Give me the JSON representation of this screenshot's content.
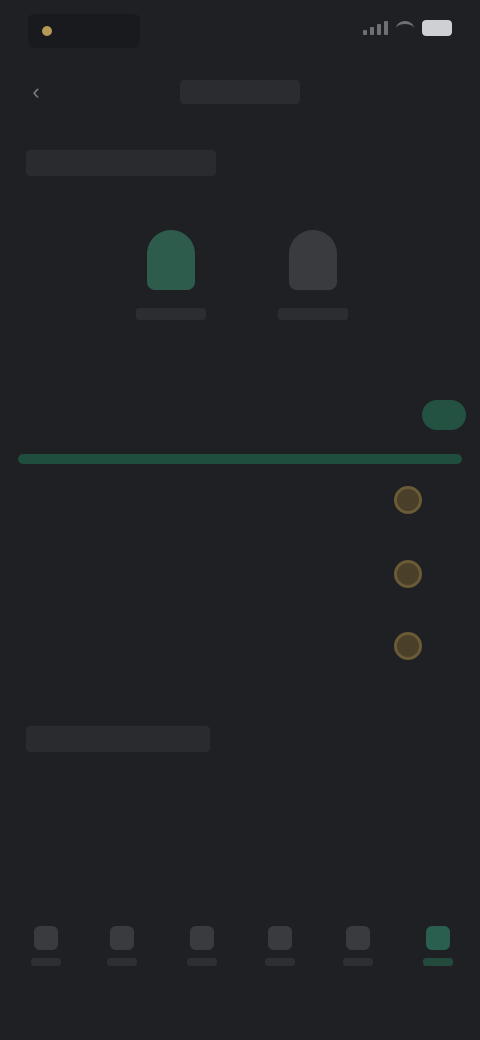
{
  "status_bar": {
    "time": "",
    "icons": [
      "signal-icon",
      "wifi-icon",
      "battery-icon"
    ]
  },
  "header": {
    "title": "",
    "back_icon": "arrow-left-icon"
  },
  "section1": {
    "heading": ""
  },
  "modes": [
    {
      "label": "",
      "icon": "shield-icon",
      "selected": true
    },
    {
      "label": "",
      "icon": "bell-icon",
      "selected": false
    }
  ],
  "primary_setting": {
    "label_line1": "",
    "label_line2": "",
    "value": "",
    "toggle": "on"
  },
  "options": [
    {
      "label": ""
    },
    {
      "label": ""
    },
    {
      "label": ""
    }
  ],
  "section2": {
    "heading": ""
  },
  "secondary_setting": {
    "label_line1": "",
    "label_line2": "",
    "value_line1": "",
    "value_line2": ""
  },
  "nav": [
    {
      "label": "",
      "icon": "home-icon"
    },
    {
      "label": "",
      "icon": "chart-icon"
    },
    {
      "label": "",
      "icon": "list-icon"
    },
    {
      "label": "",
      "icon": "wallet-icon"
    },
    {
      "label": "",
      "icon": "user-icon"
    },
    {
      "label": "",
      "icon": "settings-icon",
      "active": true
    }
  ],
  "colors": {
    "background": "#1f2023",
    "accent_green": "#2d5c4c",
    "accent_gold": "#b59a57"
  }
}
